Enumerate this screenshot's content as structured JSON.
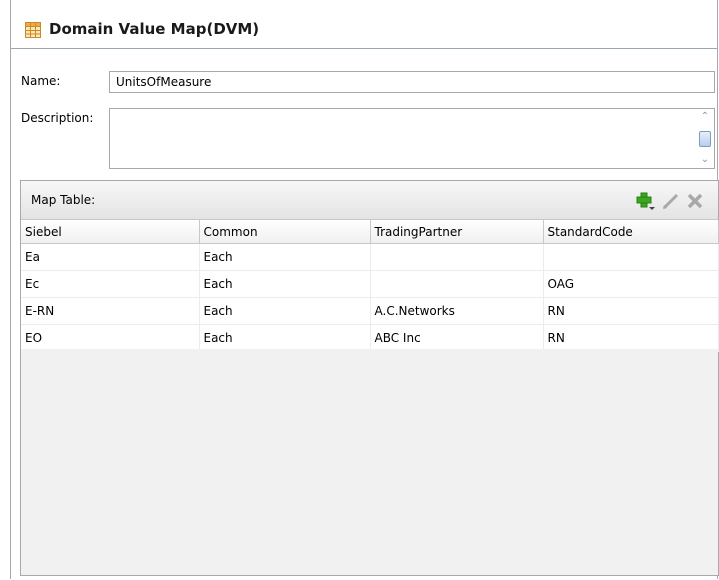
{
  "header": {
    "title": "Domain Value Map(DVM)",
    "icon": "table-icon"
  },
  "form": {
    "name_label": "Name:",
    "name_value": "UnitsOfMeasure",
    "description_label": "Description:",
    "description_value": ""
  },
  "map_table": {
    "label": "Map Table:",
    "toolbar": {
      "add_icon": "add-icon",
      "edit_icon": "edit-pencil-icon",
      "delete_icon": "delete-icon",
      "add_color": "#3aa81f",
      "disabled_color": "#a8a8a8"
    },
    "columns": [
      "Siebel",
      "Common",
      "TradingPartner",
      "StandardCode"
    ],
    "rows": [
      [
        "Ea",
        "Each",
        "",
        ""
      ],
      [
        "Ec",
        "Each",
        "",
        "OAG"
      ],
      [
        "E-RN",
        "Each",
        "A.C.Networks",
        "RN"
      ],
      [
        "EO",
        "Each",
        "ABC Inc",
        "RN"
      ]
    ]
  }
}
